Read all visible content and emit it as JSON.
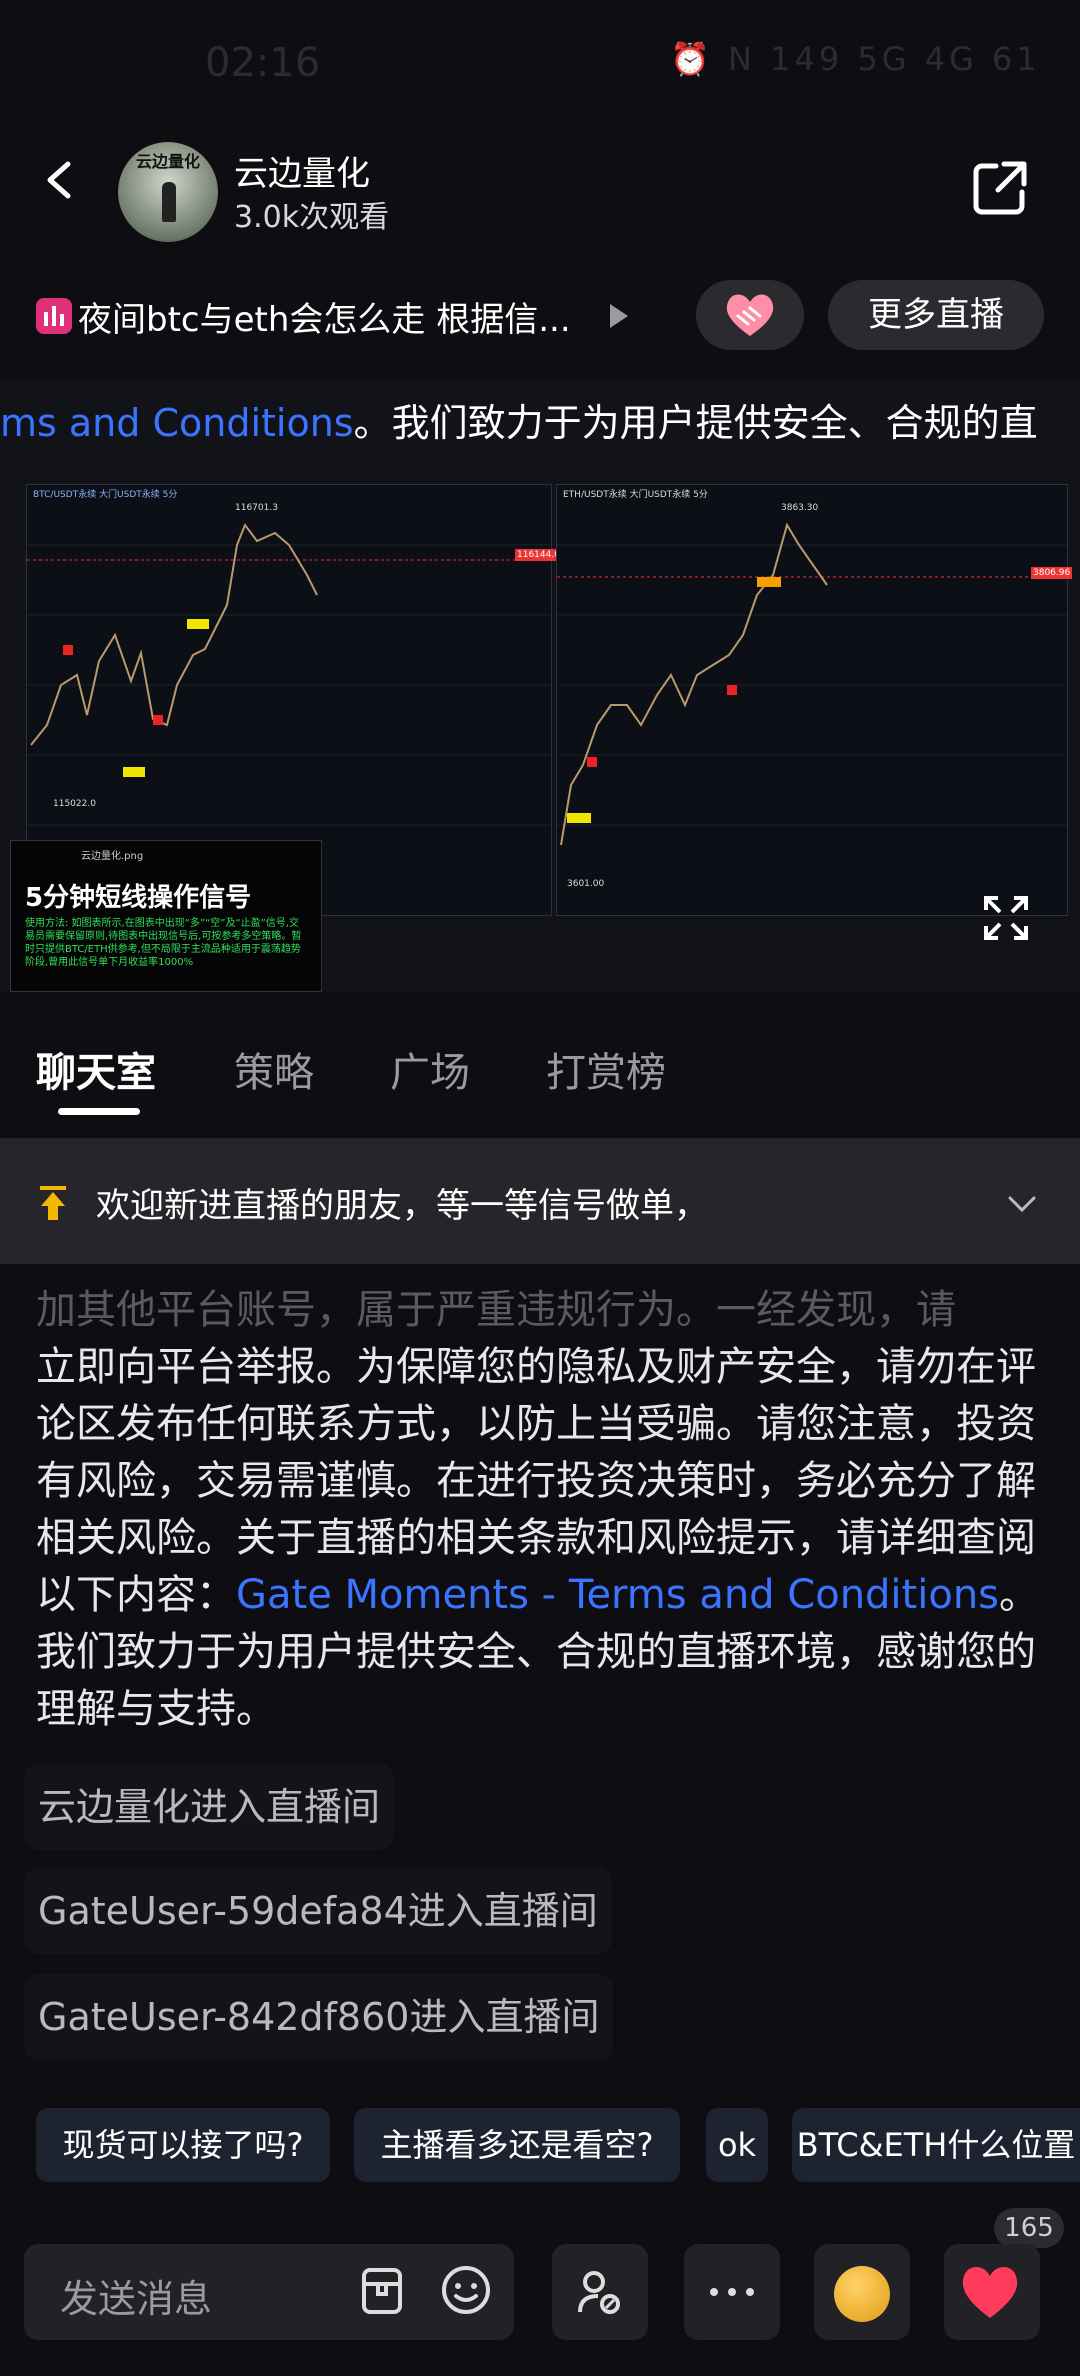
{
  "status_bar": {
    "time": "02:16",
    "icons_text": "⏰ N 149 5G 4G 61"
  },
  "header": {
    "avatar_text": "云边量化",
    "channel_name": "云边量化",
    "views": "3.0k次观看"
  },
  "title_row": {
    "title": "夜间btc与eth会怎么走 根据信...",
    "more_live": "更多直播"
  },
  "video": {
    "marquee_link": "ms and Conditions",
    "marquee_text": "。我们致力于为用户提供安全、合规的直",
    "left_chart_title": "BTC/USDT永续 大门USDT永续 5分",
    "left_price_top": "116701.3",
    "left_price_low": "115022.0",
    "left_price_tag": "116144.0",
    "right_chart_title": "ETH/USDT永续 大门USDT永续 5分",
    "right_price_top": "3863.30",
    "right_price_low": "3601.00",
    "right_price_tag": "3806.96",
    "signal_file": "云边量化.png",
    "signal_title": "5分钟短线操作信号",
    "signal_body": "使用方法: 如图表所示,在图表中出现“多”“空”及“止盈”信号,交易员需要保留原则,待图表中出现信号后,可按参考多空策略。暂时只提供BTC/ETH供参考,但不局限于主流品种适用于震荡趋势阶段,曾用此信号单下月收益率1000%"
  },
  "tabs": [
    {
      "label": "聊天室",
      "active": true
    },
    {
      "label": "策略",
      "active": false
    },
    {
      "label": "广场",
      "active": false
    },
    {
      "label": "打赏榜",
      "active": false
    }
  ],
  "pinned": {
    "text": "欢迎新进直播的朋友，等一等信号做单，"
  },
  "notice": {
    "faded_line": "加其他平台账号，属于严重违规行为。一经发现，请",
    "text_before": "立即向平台举报。为保障您的隐私及财产安全，请勿在评论区发布任何联系方式，以防上当受骗。请您注意，投资有风险，交易需谨慎。在进行投资决策时，务必充分了解相关风险。关于直播的相关条款和风险提示，请详细查阅以下内容：",
    "link": "Gate Moments - Terms and Conditions",
    "text_after": "。我们致力于为用户提供安全、合规的直播环境，感谢您的理解与支持。"
  },
  "entries": [
    "云边量化进入直播间",
    "GateUser-59defa84进入直播间",
    "GateUser-842df860进入直播间"
  ],
  "quick_replies": [
    "现货可以接了吗?",
    "主播看多还是看空?",
    "ok",
    "BTC&ETH什么位置"
  ],
  "bottom": {
    "input_placeholder": "发送消息",
    "like_count": "165"
  },
  "colors": {
    "link": "#3b74ff",
    "tab_active": "#ffffff",
    "pin_arrow": "#f5b800",
    "heart": "#ff3b5c"
  }
}
